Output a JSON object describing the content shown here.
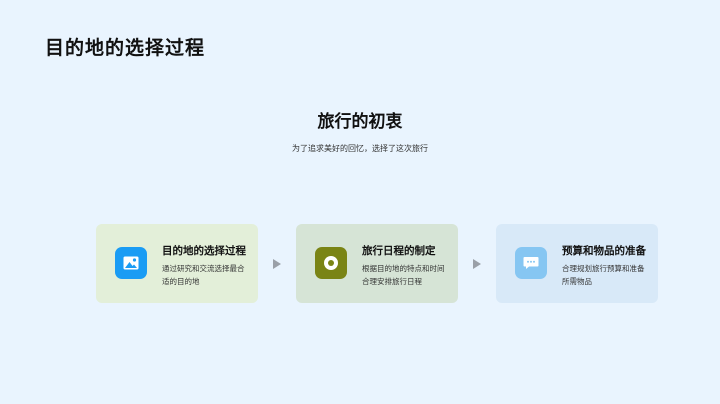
{
  "slide": {
    "title": "目的地的选择过程",
    "heading": "旅行的初衷",
    "subheading": "为了追求美好的回忆，选择了这次旅行"
  },
  "cards": [
    {
      "title": "目的地的选择过程",
      "description": "通过研究和交流选择最合适的目的地",
      "icon": "image-icon",
      "icon_color": "#1a9cf4",
      "bg_color": "#e3efd9"
    },
    {
      "title": "旅行日程的制定",
      "description": "根据目的地的特点和时间合理安排旅行日程",
      "icon": "record-icon",
      "icon_color": "#7a8415",
      "bg_color": "#d6e4d6"
    },
    {
      "title": "预算和物品的准备",
      "description": "合理规划旅行预算和准备所需物品",
      "icon": "chat-icon",
      "icon_color": "#86c6f2",
      "bg_color": "#d8e9f8"
    }
  ],
  "colors": {
    "background": "#e9f4fe",
    "arrow": "#9aa0a8"
  }
}
